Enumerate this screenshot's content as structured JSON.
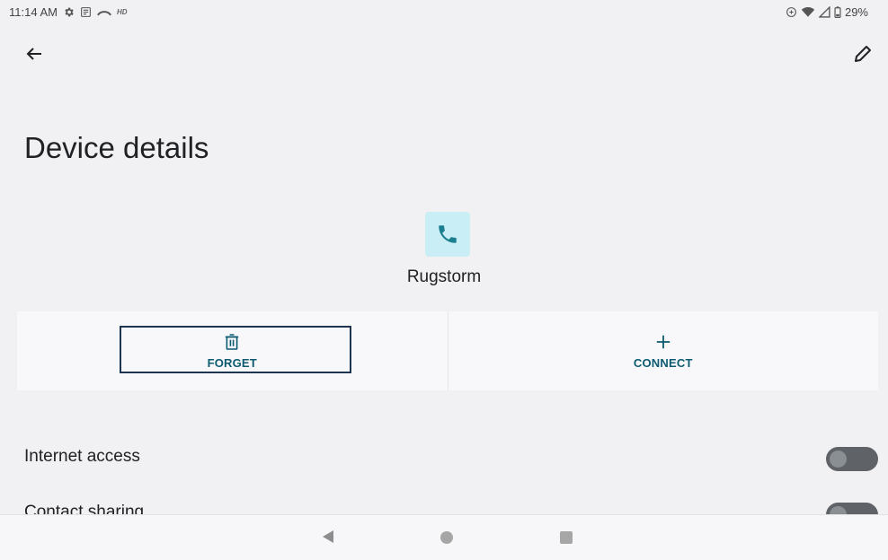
{
  "status_bar": {
    "time": "11:14 AM",
    "hd_badge": "HD",
    "battery_percent": "29%",
    "left_icons": [
      "gear-icon",
      "news-icon",
      "missed-call-icon"
    ],
    "right_icons": [
      "data-saver-icon",
      "wifi-icon",
      "signal-icon",
      "battery-icon"
    ]
  },
  "header": {
    "back_icon": "arrow-left-icon",
    "edit_icon": "pencil-icon"
  },
  "page": {
    "title": "Device details"
  },
  "device": {
    "icon": "phone-icon",
    "name": "Rugstorm",
    "icon_bg": "#c9eef5",
    "icon_color": "#1b7f90"
  },
  "actions": [
    {
      "label": "FORGET",
      "icon": "trash-icon",
      "focused": true
    },
    {
      "label": "CONNECT",
      "icon": "plus-icon",
      "focused": false
    }
  ],
  "preferences": [
    {
      "label": "Internet access",
      "enabled": false
    },
    {
      "label": "Contact sharing",
      "enabled": false
    }
  ],
  "colors": {
    "accent": "#0b5a70",
    "background": "#f1f1f3",
    "focus_border": "#1d3550",
    "toggle_track": "#5f6368"
  },
  "nav_bar": {
    "buttons": [
      "back-triangle-icon",
      "home-circle-icon",
      "recents-square-icon"
    ]
  }
}
